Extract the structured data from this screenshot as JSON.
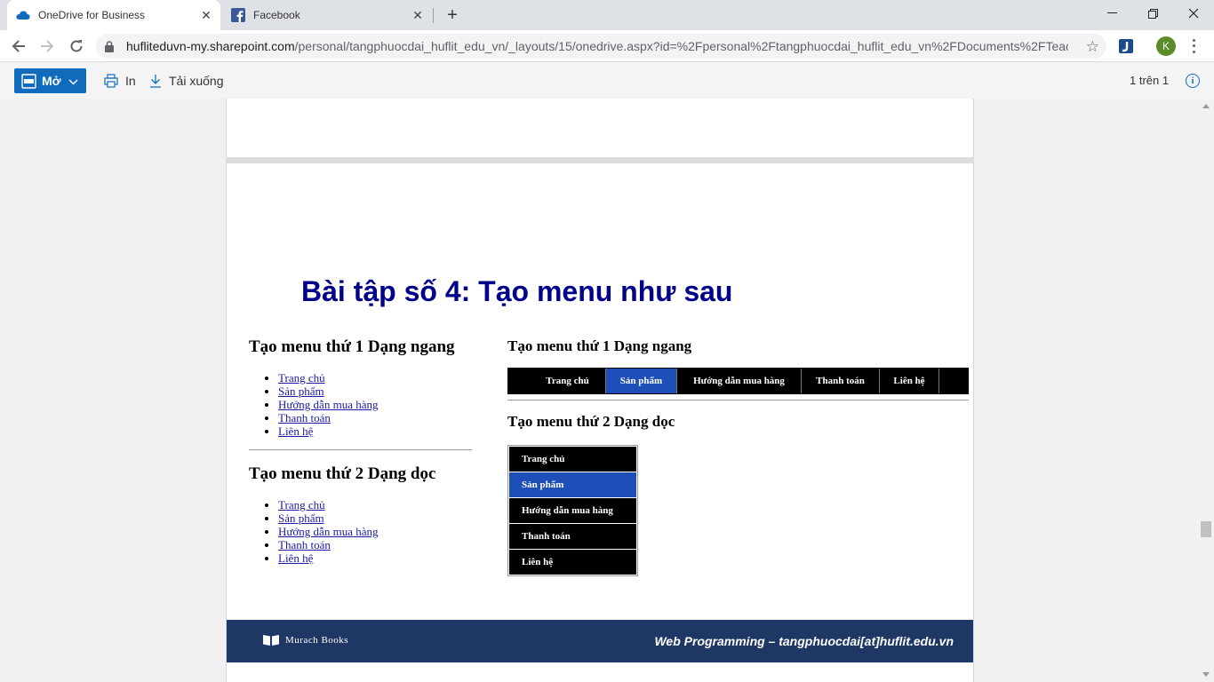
{
  "browser": {
    "tabs": [
      {
        "title": "OneDrive for Business",
        "icon": "onedrive-cloud-icon",
        "active": true
      },
      {
        "title": "Facebook",
        "icon": "facebook-icon",
        "active": false
      }
    ],
    "url_domain": "hufliteduvn-my.sharepoint.com",
    "url_path": "/personal/tangphuocdai_huflit_edu_vn/_layouts/15/onedrive.aspx?id=%2Fpersonal%2Ftangphuocdai_huflit_edu_vn%2FDocuments%2FTeac...",
    "profile_initial": "K",
    "new_tab_symbol": "+",
    "colors": {
      "accent": "#0f6cbd",
      "chrome_bg": "#dee1e6"
    }
  },
  "pdf_toolbar": {
    "open_label": "Mở",
    "print_label": "In",
    "download_label": "Tải xuống",
    "page_count": "1 trên 1",
    "info_symbol": "i"
  },
  "slide": {
    "title": "Bài tập số 4: Tạo menu như sau",
    "left": {
      "heading1": "Tạo menu thứ 1 Dạng ngang",
      "list1": [
        "Trang chủ",
        "Sản phẩm",
        "Hướng dẫn mua hàng",
        "Thanh toán",
        "Liên hệ"
      ],
      "heading2": "Tạo menu thứ 2 Dạng dọc",
      "list2": [
        "Trang chủ",
        "Sản phẩm",
        "Hướng dẫn mua hàng",
        "Thanh toán",
        "Liên hệ"
      ]
    },
    "right": {
      "heading1": "Tạo menu thứ 1 Dạng ngang",
      "hmenu": [
        "Trang chủ",
        "Sản phẩm",
        "Hướng dẫn mua hàng",
        "Thanh toán",
        "Liên hệ"
      ],
      "hmenu_active_index": 1,
      "heading2": "Tạo menu thứ 2 Dạng dọc",
      "vmenu": [
        "Trang chủ",
        "Sản phẩm",
        "Hướng dẫn mua hàng",
        "Thanh toán",
        "Liên hệ"
      ],
      "vmenu_active_index": 1,
      "menu_colors": {
        "background": "#000000",
        "active": "#1e4fb8",
        "text": "#ffffff"
      }
    },
    "footer": {
      "brand": "Murach Books",
      "text": "Web Programming – tangphuocdai[at]huflit.edu.vn",
      "band_color": "#1f3764"
    }
  }
}
